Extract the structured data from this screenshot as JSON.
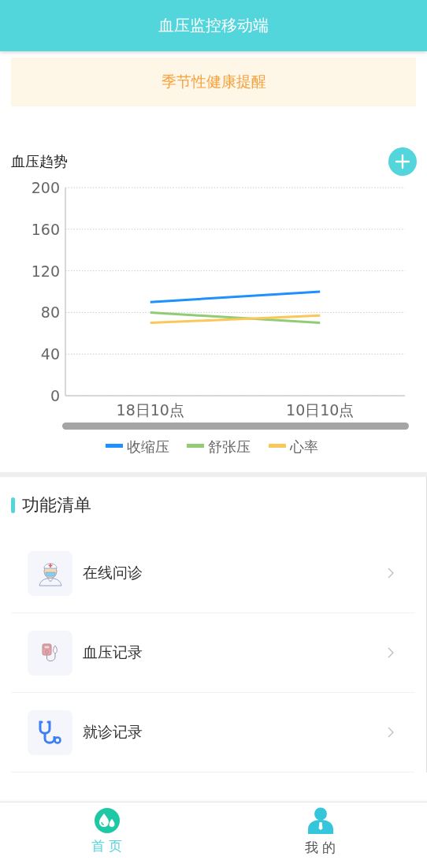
{
  "header": {
    "title": "血压监控移动端"
  },
  "notice": {
    "text": "季节性健康提醒"
  },
  "trend": {
    "title": "血压趋势",
    "chart_data": {
      "type": "line",
      "grid": true,
      "legend": true,
      "categories": [
        "18日10点",
        "10日10点"
      ],
      "ylim": [
        0,
        200
      ],
      "yticks": [
        0,
        40,
        80,
        120,
        160,
        200
      ],
      "series": [
        {
          "name": "收缩压",
          "color": "#1e90ff",
          "values": [
            90,
            100
          ]
        },
        {
          "name": "舒张压",
          "color": "#91cc75",
          "values": [
            80,
            70
          ]
        },
        {
          "name": "心率",
          "color": "#fac858",
          "values": [
            70,
            77
          ]
        }
      ]
    }
  },
  "features": {
    "title": "功能清单",
    "items": [
      {
        "label": "在线问诊"
      },
      {
        "label": "血压记录"
      },
      {
        "label": "就诊记录"
      }
    ]
  },
  "tabbar": [
    {
      "label": "首 页",
      "selected": true
    },
    {
      "label": "我 的",
      "selected": false
    }
  ]
}
